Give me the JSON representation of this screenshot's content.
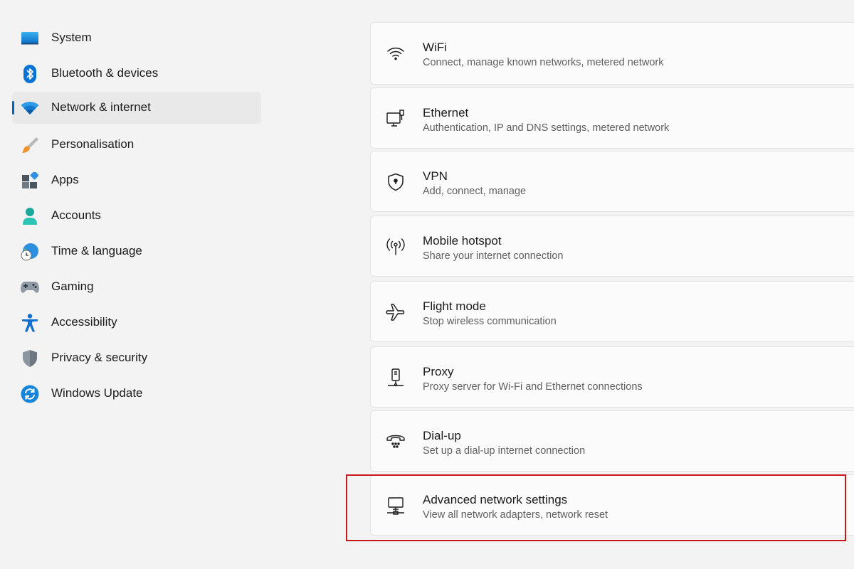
{
  "sidebar": {
    "items": [
      {
        "label": "System",
        "icon": "system-icon"
      },
      {
        "label": "Bluetooth & devices",
        "icon": "bluetooth-icon"
      },
      {
        "label": "Network & internet",
        "icon": "wifi-icon",
        "active": true
      },
      {
        "label": "Personalisation",
        "icon": "paintbrush-icon"
      },
      {
        "label": "Apps",
        "icon": "apps-icon"
      },
      {
        "label": "Accounts",
        "icon": "person-icon"
      },
      {
        "label": "Time & language",
        "icon": "globe-clock-icon"
      },
      {
        "label": "Gaming",
        "icon": "gamepad-icon"
      },
      {
        "label": "Accessibility",
        "icon": "accessibility-icon"
      },
      {
        "label": "Privacy & security",
        "icon": "shield-icon"
      },
      {
        "label": "Windows Update",
        "icon": "update-icon"
      }
    ]
  },
  "cards": [
    {
      "title": "WiFi",
      "subtitle": "Connect, manage known networks, metered network",
      "icon": "wifi-outline-icon"
    },
    {
      "title": "Ethernet",
      "subtitle": "Authentication, IP and DNS settings, metered network",
      "icon": "ethernet-icon"
    },
    {
      "title": "VPN",
      "subtitle": "Add, connect, manage",
      "icon": "vpn-shield-icon"
    },
    {
      "title": "Mobile hotspot",
      "subtitle": "Share your internet connection",
      "icon": "hotspot-icon"
    },
    {
      "title": "Flight mode",
      "subtitle": "Stop wireless communication",
      "icon": "airplane-icon"
    },
    {
      "title": "Proxy",
      "subtitle": "Proxy server for Wi-Fi and Ethernet connections",
      "icon": "proxy-icon"
    },
    {
      "title": "Dial-up",
      "subtitle": "Set up a dial-up internet connection",
      "icon": "phone-icon"
    },
    {
      "title": "Advanced network settings",
      "subtitle": "View all network adapters, network reset",
      "icon": "network-computer-icon"
    }
  ],
  "colors": {
    "accent": "#0067c0",
    "highlight": "#c8161d"
  }
}
